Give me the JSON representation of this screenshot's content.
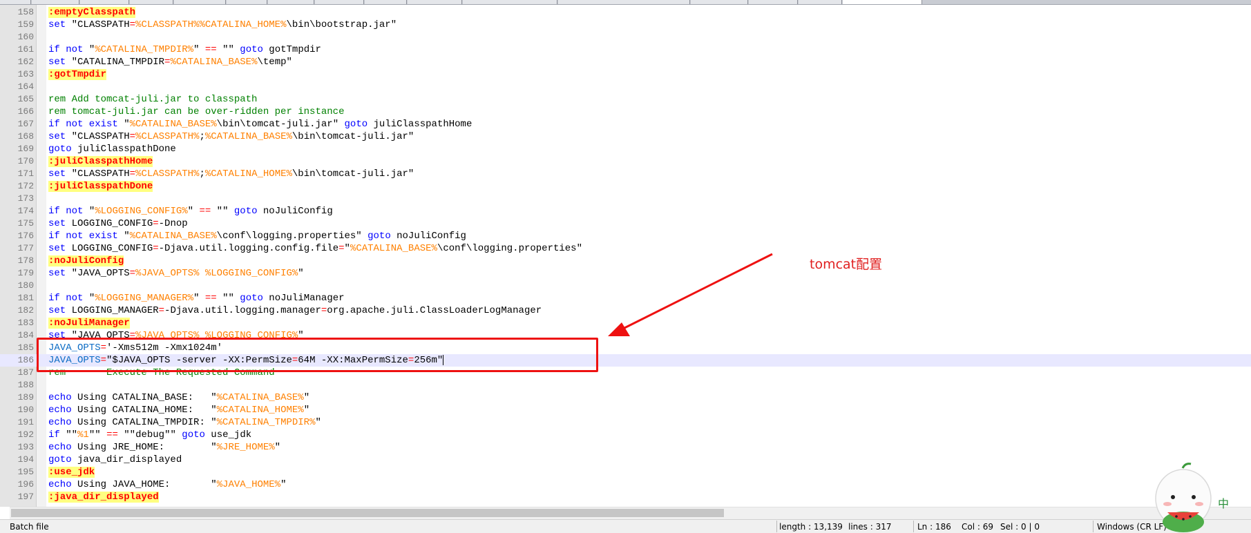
{
  "lines": [
    {
      "num": "158",
      "tokens": [
        {
          "t": ":emptyClasspath",
          "c": "lbl"
        }
      ]
    },
    {
      "num": "159",
      "tokens": [
        {
          "t": "set",
          "c": "kw"
        },
        {
          "t": " \"CLASSPATH"
        },
        {
          "t": "=",
          "c": "op"
        },
        {
          "t": "%CLASSPATH%%CATALINA_HOME%",
          "c": "var"
        },
        {
          "t": "\\bin\\bootstrap.jar\""
        }
      ]
    },
    {
      "num": "160",
      "tokens": []
    },
    {
      "num": "161",
      "tokens": [
        {
          "t": "if not",
          "c": "kw"
        },
        {
          "t": " \""
        },
        {
          "t": "%CATALINA_TMPDIR%",
          "c": "var"
        },
        {
          "t": "\" "
        },
        {
          "t": "==",
          "c": "op"
        },
        {
          "t": " \"\" "
        },
        {
          "t": "goto",
          "c": "kw"
        },
        {
          "t": " gotTmpdir"
        }
      ]
    },
    {
      "num": "162",
      "tokens": [
        {
          "t": "set",
          "c": "kw"
        },
        {
          "t": " \"CATALINA_TMPDIR"
        },
        {
          "t": "=",
          "c": "op"
        },
        {
          "t": "%CATALINA_BASE%",
          "c": "var"
        },
        {
          "t": "\\temp\""
        }
      ]
    },
    {
      "num": "163",
      "tokens": [
        {
          "t": ":gotTmpdir",
          "c": "lbl"
        }
      ]
    },
    {
      "num": "164",
      "tokens": []
    },
    {
      "num": "165",
      "tokens": [
        {
          "t": "rem Add tomcat-juli.jar to classpath",
          "c": "com"
        }
      ]
    },
    {
      "num": "166",
      "tokens": [
        {
          "t": "rem tomcat-juli.jar can be over-ridden per instance",
          "c": "com"
        }
      ]
    },
    {
      "num": "167",
      "tokens": [
        {
          "t": "if not exist",
          "c": "kw"
        },
        {
          "t": " \""
        },
        {
          "t": "%CATALINA_BASE%",
          "c": "var"
        },
        {
          "t": "\\bin\\tomcat-juli.jar\" "
        },
        {
          "t": "goto",
          "c": "kw"
        },
        {
          "t": " juliClasspathHome"
        }
      ]
    },
    {
      "num": "168",
      "tokens": [
        {
          "t": "set",
          "c": "kw"
        },
        {
          "t": " \"CLASSPATH"
        },
        {
          "t": "=",
          "c": "op"
        },
        {
          "t": "%CLASSPATH%",
          "c": "var"
        },
        {
          "t": ";"
        },
        {
          "t": "%CATALINA_BASE%",
          "c": "var"
        },
        {
          "t": "\\bin\\tomcat-juli.jar\""
        }
      ]
    },
    {
      "num": "169",
      "tokens": [
        {
          "t": "goto",
          "c": "kw"
        },
        {
          "t": " juliClasspathDone"
        }
      ]
    },
    {
      "num": "170",
      "tokens": [
        {
          "t": ":juliClasspathHome",
          "c": "lbl"
        }
      ]
    },
    {
      "num": "171",
      "tokens": [
        {
          "t": "set",
          "c": "kw"
        },
        {
          "t": " \"CLASSPATH"
        },
        {
          "t": "=",
          "c": "op"
        },
        {
          "t": "%CLASSPATH%",
          "c": "var"
        },
        {
          "t": ";"
        },
        {
          "t": "%CATALINA_HOME%",
          "c": "var"
        },
        {
          "t": "\\bin\\tomcat-juli.jar\""
        }
      ]
    },
    {
      "num": "172",
      "tokens": [
        {
          "t": ":juliClasspathDone",
          "c": "lbl"
        }
      ]
    },
    {
      "num": "173",
      "tokens": []
    },
    {
      "num": "174",
      "tokens": [
        {
          "t": "if not",
          "c": "kw"
        },
        {
          "t": " \""
        },
        {
          "t": "%LOGGING_CONFIG%",
          "c": "var"
        },
        {
          "t": "\" "
        },
        {
          "t": "==",
          "c": "op"
        },
        {
          "t": " \"\" "
        },
        {
          "t": "goto",
          "c": "kw"
        },
        {
          "t": " noJuliConfig"
        }
      ]
    },
    {
      "num": "175",
      "tokens": [
        {
          "t": "set",
          "c": "kw"
        },
        {
          "t": " LOGGING_CONFIG"
        },
        {
          "t": "=",
          "c": "op"
        },
        {
          "t": "-Dnop"
        }
      ]
    },
    {
      "num": "176",
      "tokens": [
        {
          "t": "if not exist",
          "c": "kw"
        },
        {
          "t": " \""
        },
        {
          "t": "%CATALINA_BASE%",
          "c": "var"
        },
        {
          "t": "\\conf\\logging.properties\" "
        },
        {
          "t": "goto",
          "c": "kw"
        },
        {
          "t": " noJuliConfig"
        }
      ]
    },
    {
      "num": "177",
      "tokens": [
        {
          "t": "set",
          "c": "kw"
        },
        {
          "t": " LOGGING_CONFIG"
        },
        {
          "t": "=",
          "c": "op"
        },
        {
          "t": "-Djava.util.logging.config.file"
        },
        {
          "t": "=",
          "c": "op"
        },
        {
          "t": "\""
        },
        {
          "t": "%CATALINA_BASE%",
          "c": "var"
        },
        {
          "t": "\\conf\\logging.properties\""
        }
      ]
    },
    {
      "num": "178",
      "tokens": [
        {
          "t": ":noJuliConfig",
          "c": "lbl"
        }
      ]
    },
    {
      "num": "179",
      "tokens": [
        {
          "t": "set",
          "c": "kw"
        },
        {
          "t": " \"JAVA_OPTS"
        },
        {
          "t": "=",
          "c": "op"
        },
        {
          "t": "%JAVA_OPTS% %LOGGING_CONFIG%",
          "c": "var"
        },
        {
          "t": "\""
        }
      ]
    },
    {
      "num": "180",
      "tokens": []
    },
    {
      "num": "181",
      "tokens": [
        {
          "t": "if not",
          "c": "kw"
        },
        {
          "t": " \""
        },
        {
          "t": "%LOGGING_MANAGER%",
          "c": "var"
        },
        {
          "t": "\" "
        },
        {
          "t": "==",
          "c": "op"
        },
        {
          "t": " \"\" "
        },
        {
          "t": "goto",
          "c": "kw"
        },
        {
          "t": " noJuliManager"
        }
      ]
    },
    {
      "num": "182",
      "tokens": [
        {
          "t": "set",
          "c": "kw"
        },
        {
          "t": " LOGGING_MANAGER"
        },
        {
          "t": "=",
          "c": "op"
        },
        {
          "t": "-Djava.util.logging.manager"
        },
        {
          "t": "=",
          "c": "op"
        },
        {
          "t": "org.apache.juli.ClassLoaderLogManager"
        }
      ]
    },
    {
      "num": "183",
      "tokens": [
        {
          "t": ":noJuliManager",
          "c": "lbl"
        }
      ]
    },
    {
      "num": "184",
      "tokens": [
        {
          "t": "set",
          "c": "kw"
        },
        {
          "t": " \"JAVA_OPTS"
        },
        {
          "t": "=",
          "c": "op"
        },
        {
          "t": "%JAVA_OPTS% %LOGGING_CONFIG%",
          "c": "var"
        },
        {
          "t": "\""
        }
      ]
    },
    {
      "num": "185",
      "tokens": [
        {
          "t": "JAVA_OPTS",
          "c": "jo"
        },
        {
          "t": "=",
          "c": "op"
        },
        {
          "t": "'-Xms512m -Xmx1024m'"
        }
      ]
    },
    {
      "num": "186",
      "current": true,
      "tokens": [
        {
          "t": "JAVA_OPTS",
          "c": "jo"
        },
        {
          "t": "=",
          "c": "op"
        },
        {
          "t": "\"$JAVA_OPTS -server -XX:PermSize"
        },
        {
          "t": "=",
          "c": "op"
        },
        {
          "t": "64M -XX:MaxPermSize"
        },
        {
          "t": "=",
          "c": "op"
        },
        {
          "t": "256m\""
        }
      ]
    },
    {
      "num": "187",
      "tokens": [
        {
          "t": "rem       Execute The Requested Command",
          "c": "com"
        }
      ]
    },
    {
      "num": "188",
      "tokens": []
    },
    {
      "num": "189",
      "tokens": [
        {
          "t": "echo",
          "c": "kw"
        },
        {
          "t": " Using CATALINA_BASE:   \""
        },
        {
          "t": "%CATALINA_BASE%",
          "c": "var"
        },
        {
          "t": "\""
        }
      ]
    },
    {
      "num": "190",
      "tokens": [
        {
          "t": "echo",
          "c": "kw"
        },
        {
          "t": " Using CATALINA_HOME:   \""
        },
        {
          "t": "%CATALINA_HOME%",
          "c": "var"
        },
        {
          "t": "\""
        }
      ]
    },
    {
      "num": "191",
      "tokens": [
        {
          "t": "echo",
          "c": "kw"
        },
        {
          "t": " Using CATALINA_TMPDIR: \""
        },
        {
          "t": "%CATALINA_TMPDIR%",
          "c": "var"
        },
        {
          "t": "\""
        }
      ]
    },
    {
      "num": "192",
      "tokens": [
        {
          "t": "if",
          "c": "kw"
        },
        {
          "t": " \"\""
        },
        {
          "t": "%1",
          "c": "var"
        },
        {
          "t": "\"\" "
        },
        {
          "t": "==",
          "c": "op"
        },
        {
          "t": " \"\"debug\"\" "
        },
        {
          "t": "goto",
          "c": "kw"
        },
        {
          "t": " use_jdk"
        }
      ]
    },
    {
      "num": "193",
      "tokens": [
        {
          "t": "echo",
          "c": "kw"
        },
        {
          "t": " Using JRE_HOME:        \""
        },
        {
          "t": "%JRE_HOME%",
          "c": "var"
        },
        {
          "t": "\""
        }
      ]
    },
    {
      "num": "194",
      "tokens": [
        {
          "t": "goto",
          "c": "kw"
        },
        {
          "t": " java_dir_displayed"
        }
      ]
    },
    {
      "num": "195",
      "tokens": [
        {
          "t": ":use_jdk",
          "c": "lbl"
        }
      ]
    },
    {
      "num": "196",
      "tokens": [
        {
          "t": "echo",
          "c": "kw"
        },
        {
          "t": " Using JAVA_HOME:       \""
        },
        {
          "t": "%JAVA_HOME%",
          "c": "var"
        },
        {
          "t": "\""
        }
      ]
    },
    {
      "num": "197",
      "tokens": [
        {
          "t": ":java_dir_displayed",
          "c": "lbl"
        }
      ]
    }
  ],
  "annotation": {
    "text": "tomcat配置"
  },
  "status": {
    "file_type": "Batch file",
    "length": "length : 13,139",
    "lines": "lines : 317",
    "ln": "Ln : 186",
    "col": "Col : 69",
    "sel": "Sel : 0 | 0",
    "eol": "Windows (CR LF)"
  },
  "ime": {
    "label": "中"
  },
  "colors": {
    "highlight_box": "#ee1111",
    "annotation": "#e02020",
    "label_bg": "#ffff80"
  },
  "icons": [
    "watermelon-mascot-icon"
  ]
}
